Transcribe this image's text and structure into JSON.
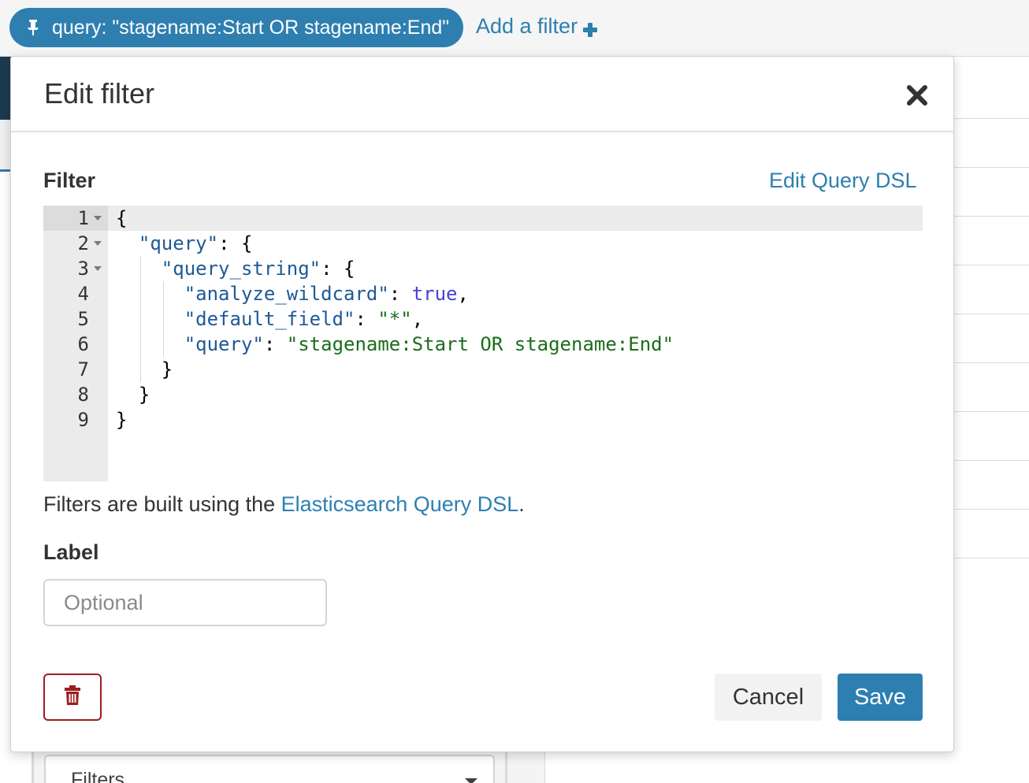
{
  "filter_bar": {
    "pill_label": "query: \"stagename:Start OR stagename:End\"",
    "pill_icon": "pin-icon",
    "add_filter_label": "Add a filter",
    "add_filter_icon": "plus-icon"
  },
  "modal": {
    "title": "Edit filter",
    "close_icon": "close-icon",
    "filter_label": "Filter",
    "edit_dsl_link": "Edit Query DSL",
    "editor": {
      "line_numbers": [
        "1",
        "2",
        "3",
        "4",
        "5",
        "6",
        "7",
        "8",
        "9"
      ],
      "lines": [
        [
          {
            "t": "{",
            "c": "plain"
          }
        ],
        [
          {
            "t": "  ",
            "c": "plain"
          },
          {
            "t": "\"query\"",
            "c": "key"
          },
          {
            "t": ": {",
            "c": "plain"
          }
        ],
        [
          {
            "t": "    ",
            "c": "plain"
          },
          {
            "t": "\"query_string\"",
            "c": "key"
          },
          {
            "t": ": {",
            "c": "plain"
          }
        ],
        [
          {
            "t": "      ",
            "c": "plain"
          },
          {
            "t": "\"analyze_wildcard\"",
            "c": "key"
          },
          {
            "t": ": ",
            "c": "plain"
          },
          {
            "t": "true",
            "c": "bool"
          },
          {
            "t": ",",
            "c": "plain"
          }
        ],
        [
          {
            "t": "      ",
            "c": "plain"
          },
          {
            "t": "\"default_field\"",
            "c": "key"
          },
          {
            "t": ": ",
            "c": "plain"
          },
          {
            "t": "\"*\"",
            "c": "str"
          },
          {
            "t": ",",
            "c": "plain"
          }
        ],
        [
          {
            "t": "      ",
            "c": "plain"
          },
          {
            "t": "\"query\"",
            "c": "key"
          },
          {
            "t": ": ",
            "c": "plain"
          },
          {
            "t": "\"stagename:Start OR stagename:End\"",
            "c": "str"
          }
        ],
        [
          {
            "t": "    }",
            "c": "plain"
          }
        ],
        [
          {
            "t": "  }",
            "c": "plain"
          }
        ],
        [
          {
            "t": "}",
            "c": "plain"
          }
        ]
      ]
    },
    "help_prefix": "Filters are built using the ",
    "help_link": "Elasticsearch Query DSL",
    "help_suffix": ".",
    "label_label": "Label",
    "label_input": {
      "value": "",
      "placeholder": "Optional"
    },
    "delete_icon": "trash-icon",
    "cancel_label": "Cancel",
    "save_label": "Save"
  },
  "background": {
    "filters_select_value": "Filters"
  },
  "colors": {
    "accent": "#2d7fb1",
    "danger": "#9c1d1d",
    "code_key": "#1d5a96",
    "code_string": "#1b6e1b",
    "code_bool": "#4b3fd6"
  }
}
